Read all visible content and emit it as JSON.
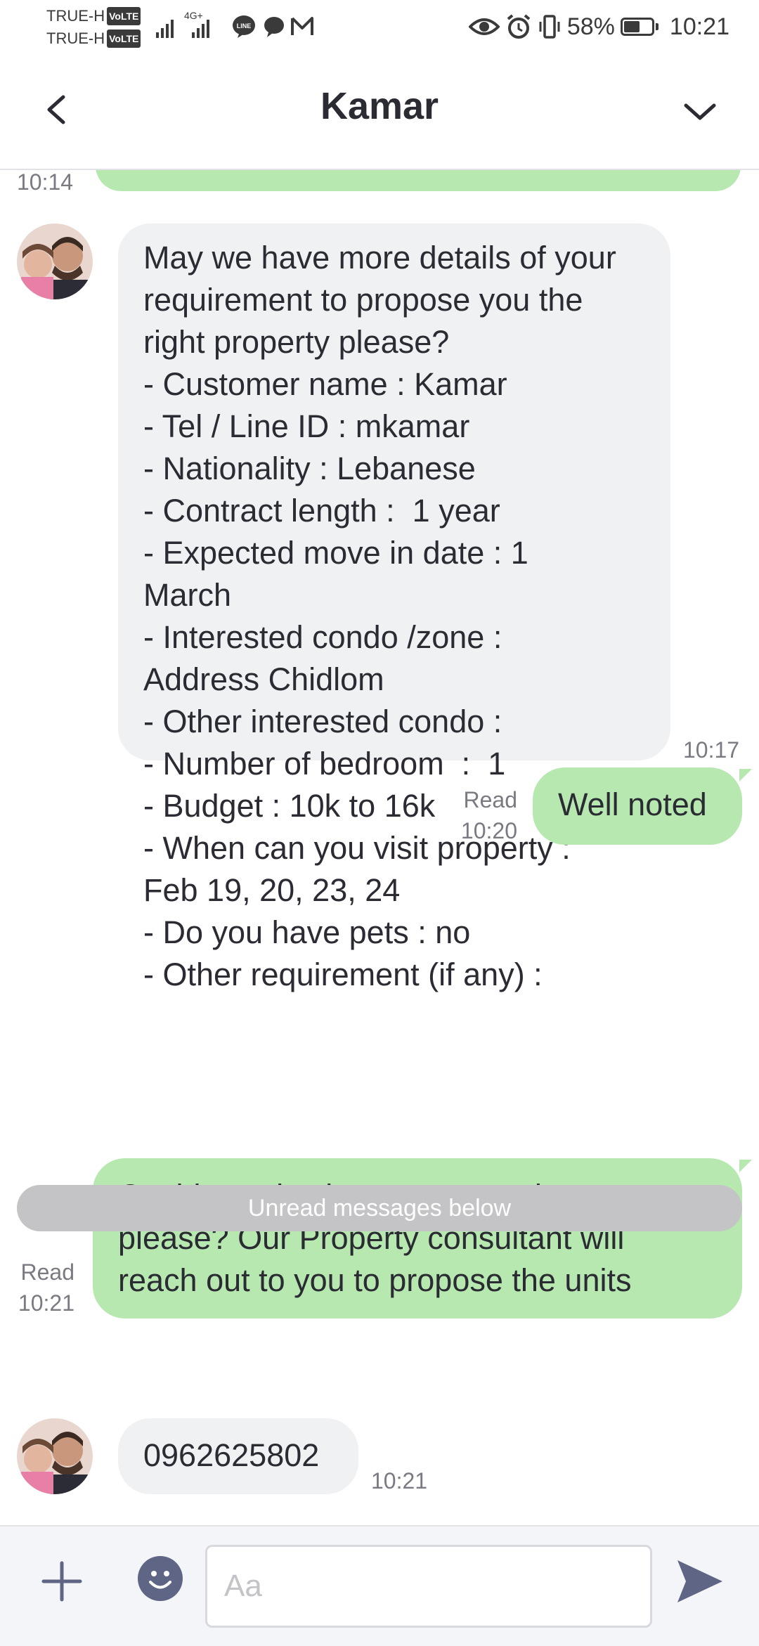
{
  "status_bar": {
    "carrier_1": "TRUE-H",
    "carrier_2": "TRUE-H",
    "volte_label": "VoLTE",
    "network_label": "4G+",
    "battery_percent": "58%",
    "battery_level": 0.58,
    "time": "10:21",
    "icons": [
      "signal-icon",
      "line-icon",
      "chat-icon",
      "gmail-icon",
      "eye-icon",
      "alarm-icon",
      "vibrate-icon",
      "battery-icon"
    ]
  },
  "header": {
    "title": "Kamar",
    "back_icon": "chevron-left-icon",
    "menu_icon": "chevron-down-icon"
  },
  "messages": {
    "top_partial_time": "10:14",
    "incoming_1": {
      "lines": [
        "May we have more details of your",
        "requirement to propose you the",
        "right property please?",
        "- Customer name : Kamar",
        "- Tel / Line ID : mkamar",
        "- Nationality : Lebanese",
        "- Contract length :  1 year",
        "- Expected move in date : 1",
        "March",
        "- Interested condo /zone :",
        "Address Chidlom",
        "- Other interested condo :",
        "- Number of bedroom  :  1",
        "- Budget : 10k to 16k",
        "- When can you visit property :",
        "Feb 19, 20, 23, 24",
        "- Do you have pets : no",
        "- Other requirement (if any) :"
      ],
      "time": "10:17"
    },
    "outgoing_1": {
      "text": "Well noted",
      "read": "Read",
      "time": "10:20"
    },
    "outgoing_2": {
      "lines": [
        "Could we also have your number",
        "please? Our Property consultant will",
        "reach out to you to propose the units"
      ],
      "read": "Read",
      "time": "10:21"
    },
    "unread_divider": "Unread messages below",
    "incoming_2": {
      "text": "0962625802",
      "time": "10:21"
    }
  },
  "input_bar": {
    "placeholder": "Aa",
    "value": "",
    "plus_icon": "plus-icon",
    "emoji_icon": "emoji-icon",
    "send_icon": "send-icon"
  },
  "colors": {
    "outgoing_bubble": "#b6e8b0",
    "incoming_bubble": "#f0f1f3",
    "divider": "#c4c4c6",
    "icon_gray": "#5f6584"
  }
}
